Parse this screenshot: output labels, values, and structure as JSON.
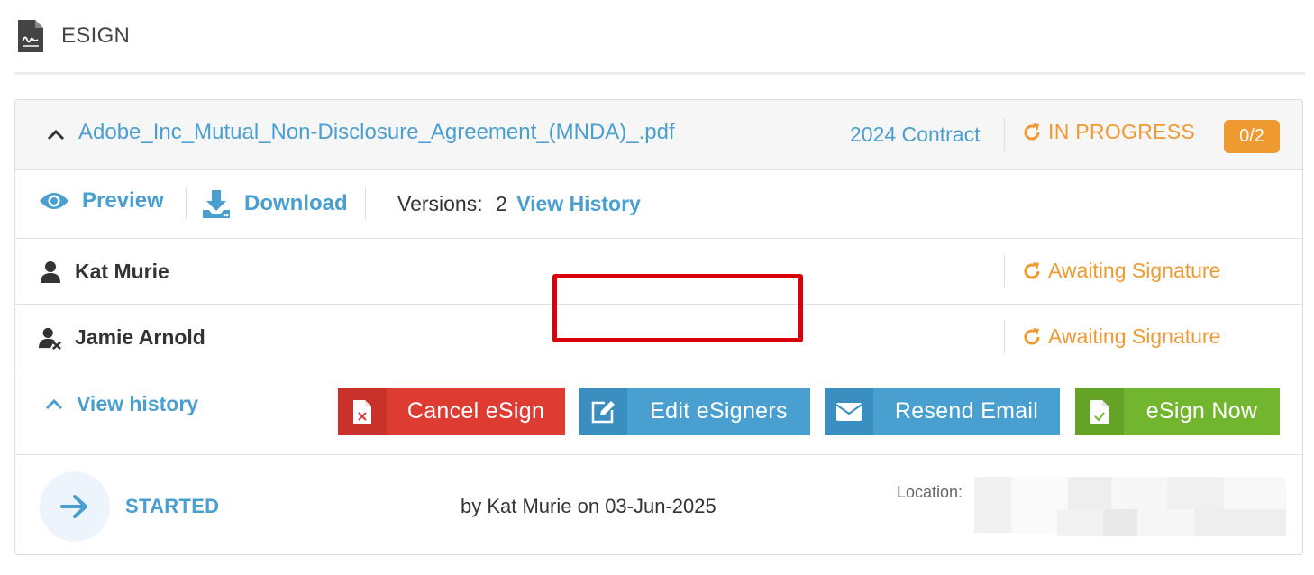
{
  "header": {
    "title": "ESIGN",
    "icon": "signature-document-icon"
  },
  "document": {
    "filename": "Adobe_Inc_Mutual_Non-Disclosure_Agreement_(MNDA)_.pdf",
    "category": "2024 Contract",
    "status": "IN PROGRESS",
    "signed_count": "0/2"
  },
  "actions": {
    "preview": "Preview",
    "download": "Download",
    "versions_label": "Versions:",
    "versions_count": "2",
    "view_history": "View History"
  },
  "signers": [
    {
      "name": "Kat Murie",
      "status": "Awaiting Signature",
      "icon": "user-icon"
    },
    {
      "name": "Jamie Arnold",
      "status": "Awaiting Signature",
      "icon": "user-edit-icon"
    }
  ],
  "controls": {
    "view_history": "View history",
    "cancel": "Cancel eSign",
    "edit": "Edit eSigners",
    "resend": "Resend Email",
    "esign_now": "eSign Now"
  },
  "history": {
    "event": "STARTED",
    "by": "by Kat Murie on 03-Jun-2025",
    "location_label": "Location:"
  },
  "colors": {
    "accent": "#4a9fd1",
    "warning": "#ef9a30",
    "danger": "#de3b33",
    "success": "#72b52e",
    "highlight": "#d9000b"
  }
}
